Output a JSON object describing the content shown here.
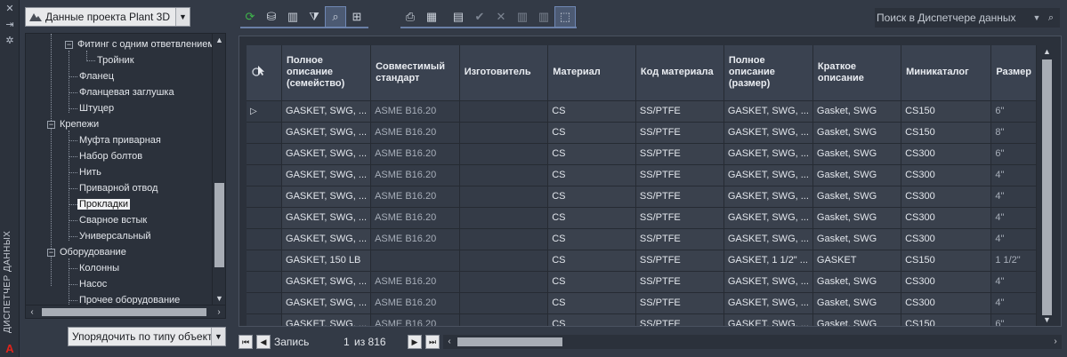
{
  "sidebar": {
    "vertical_title": "ДИСПЕТЧЕР ДАННЫХ",
    "icons": [
      "close-icon",
      "pin-icon",
      "settings-icon"
    ]
  },
  "project_select": {
    "value": "Данные проекта Plant 3D"
  },
  "tree": {
    "nodes": [
      {
        "label": "Фитинг с одним ответвлением",
        "expander": "−"
      },
      {
        "label": "Тройник"
      },
      {
        "label": "Фланец"
      },
      {
        "label": "Фланцевая заглушка"
      },
      {
        "label": "Штуцер"
      },
      {
        "label": "Крепежи",
        "expander": "−"
      },
      {
        "label": "Муфта приварная"
      },
      {
        "label": "Набор болтов"
      },
      {
        "label": "Нить"
      },
      {
        "label": "Приварной отвод"
      },
      {
        "label": "Прокладки",
        "selected": true
      },
      {
        "label": "Сварное встык"
      },
      {
        "label": "Универсальный"
      },
      {
        "label": "Оборудование",
        "expander": "−"
      },
      {
        "label": "Колонны"
      },
      {
        "label": "Насос"
      },
      {
        "label": "Прочее оборудование"
      }
    ]
  },
  "sort_select": {
    "value": "Упорядочить по типу объекта"
  },
  "toolbar": {
    "search_placeholder": "Поиск в Диспетчере данных"
  },
  "grid": {
    "columns": [
      "Полное описание (семейство)",
      "Совместимый стандарт",
      "Изготовитель",
      "Материал",
      "Код материала",
      "Полное описание (размер)",
      "Краткое описание",
      "Миникаталог",
      "Размер"
    ],
    "rows": [
      [
        "GASKET, SWG, ...",
        "ASME B16.20",
        "",
        "CS",
        "SS/PTFE",
        "GASKET, SWG, ...",
        "Gasket, SWG",
        "CS150",
        "6\""
      ],
      [
        "GASKET, SWG, ...",
        "ASME B16.20",
        "",
        "CS",
        "SS/PTFE",
        "GASKET, SWG, ...",
        "Gasket, SWG",
        "CS150",
        "8\""
      ],
      [
        "GASKET, SWG, ...",
        "ASME B16.20",
        "",
        "CS",
        "SS/PTFE",
        "GASKET, SWG, ...",
        "Gasket, SWG",
        "CS300",
        "6\""
      ],
      [
        "GASKET, SWG, ...",
        "ASME B16.20",
        "",
        "CS",
        "SS/PTFE",
        "GASKET, SWG, ...",
        "Gasket, SWG",
        "CS300",
        "4\""
      ],
      [
        "GASKET, SWG, ...",
        "ASME B16.20",
        "",
        "CS",
        "SS/PTFE",
        "GASKET, SWG, ...",
        "Gasket, SWG",
        "CS300",
        "4\""
      ],
      [
        "GASKET, SWG, ...",
        "ASME B16.20",
        "",
        "CS",
        "SS/PTFE",
        "GASKET, SWG, ...",
        "Gasket, SWG",
        "CS300",
        "4\""
      ],
      [
        "GASKET, SWG, ...",
        "ASME B16.20",
        "",
        "CS",
        "SS/PTFE",
        "GASKET, SWG, ...",
        "Gasket, SWG",
        "CS300",
        "4\""
      ],
      [
        "GASKET, 150 LB",
        "",
        "",
        "CS",
        "SS/PTFE",
        "GASKET, 1 1/2\" ...",
        "GASKET",
        "CS150",
        "1 1/2\""
      ],
      [
        "GASKET, SWG, ...",
        "ASME B16.20",
        "",
        "CS",
        "SS/PTFE",
        "GASKET, SWG, ...",
        "Gasket, SWG",
        "CS300",
        "4\""
      ],
      [
        "GASKET, SWG, ...",
        "ASME B16.20",
        "",
        "CS",
        "SS/PTFE",
        "GASKET, SWG, ...",
        "Gasket, SWG",
        "CS300",
        "4\""
      ],
      [
        "GASKET, SWG, ...",
        "ASME B16.20",
        "",
        "CS",
        "SS/PTFE",
        "GASKET, SWG, ...",
        "Gasket, SWG",
        "CS150",
        "6\""
      ]
    ]
  },
  "nav": {
    "record_label": "Запись",
    "position": "1",
    "of_label": "из 816"
  }
}
